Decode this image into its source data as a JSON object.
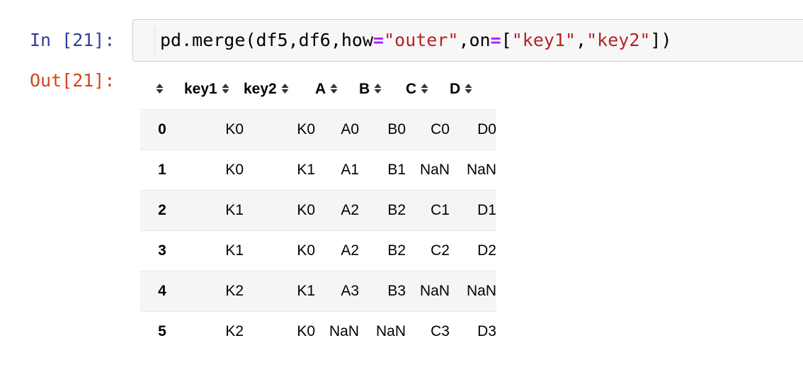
{
  "cell": {
    "in_prompt": "In [21]:",
    "out_prompt": "Out[21]:",
    "code_tokens": [
      {
        "text": "pd.merge(df5,df6,how",
        "type": "plain"
      },
      {
        "text": "=",
        "type": "op"
      },
      {
        "text": "\"outer\"",
        "type": "str"
      },
      {
        "text": ",on",
        "type": "plain"
      },
      {
        "text": "=",
        "type": "op"
      },
      {
        "text": "[",
        "type": "plain"
      },
      {
        "text": "\"key1\"",
        "type": "str"
      },
      {
        "text": ",",
        "type": "plain"
      },
      {
        "text": "\"key2\"",
        "type": "str"
      },
      {
        "text": "])",
        "type": "plain"
      }
    ]
  },
  "table": {
    "columns": [
      "",
      "key1",
      "key2",
      "A",
      "B",
      "C",
      "D"
    ],
    "rows": [
      {
        "index": "0",
        "values": [
          "K0",
          "K0",
          "A0",
          "B0",
          "C0",
          "D0"
        ]
      },
      {
        "index": "1",
        "values": [
          "K0",
          "K1",
          "A1",
          "B1",
          "NaN",
          "NaN"
        ]
      },
      {
        "index": "2",
        "values": [
          "K1",
          "K0",
          "A2",
          "B2",
          "C1",
          "D1"
        ]
      },
      {
        "index": "3",
        "values": [
          "K1",
          "K0",
          "A2",
          "B2",
          "C2",
          "D2"
        ]
      },
      {
        "index": "4",
        "values": [
          "K2",
          "K1",
          "A3",
          "B3",
          "NaN",
          "NaN"
        ]
      },
      {
        "index": "5",
        "values": [
          "K2",
          "K0",
          "NaN",
          "NaN",
          "C3",
          "D3"
        ]
      }
    ]
  },
  "icons": {
    "sort": "sort-both-icon"
  },
  "colors": {
    "in_prompt": "#303f9f",
    "out_prompt": "#d84315",
    "string": "#ba2121",
    "operator": "#aa22ff",
    "stripe": "#f5f5f5"
  }
}
